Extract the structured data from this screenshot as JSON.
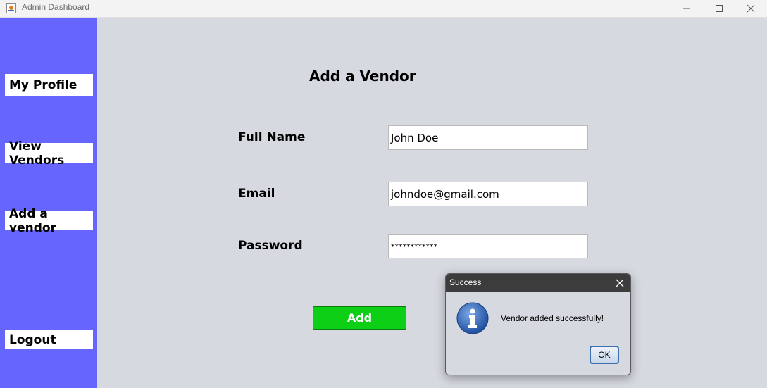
{
  "window": {
    "title": "Admin Dashboard"
  },
  "sidebar": {
    "items": [
      {
        "label": "My Profile"
      },
      {
        "label": "View Vendors"
      },
      {
        "label": "Add a vendor"
      },
      {
        "label": "Logout"
      }
    ]
  },
  "form": {
    "heading": "Add a Vendor",
    "full_name": {
      "label": "Full Name",
      "value": "John Doe"
    },
    "email": {
      "label": "Email",
      "value": "johndoe@gmail.com"
    },
    "password": {
      "label": "Password",
      "value": "************"
    },
    "add_label": "Add"
  },
  "dialog": {
    "title": "Success",
    "message": "Vendor added successfully!",
    "ok_label": "OK",
    "icon": "info-icon"
  },
  "colors": {
    "sidebar": "#6666ff",
    "background": "#d6d9e0",
    "add_button": "#0ccf16",
    "dialog_title": "#3c3c3c"
  }
}
